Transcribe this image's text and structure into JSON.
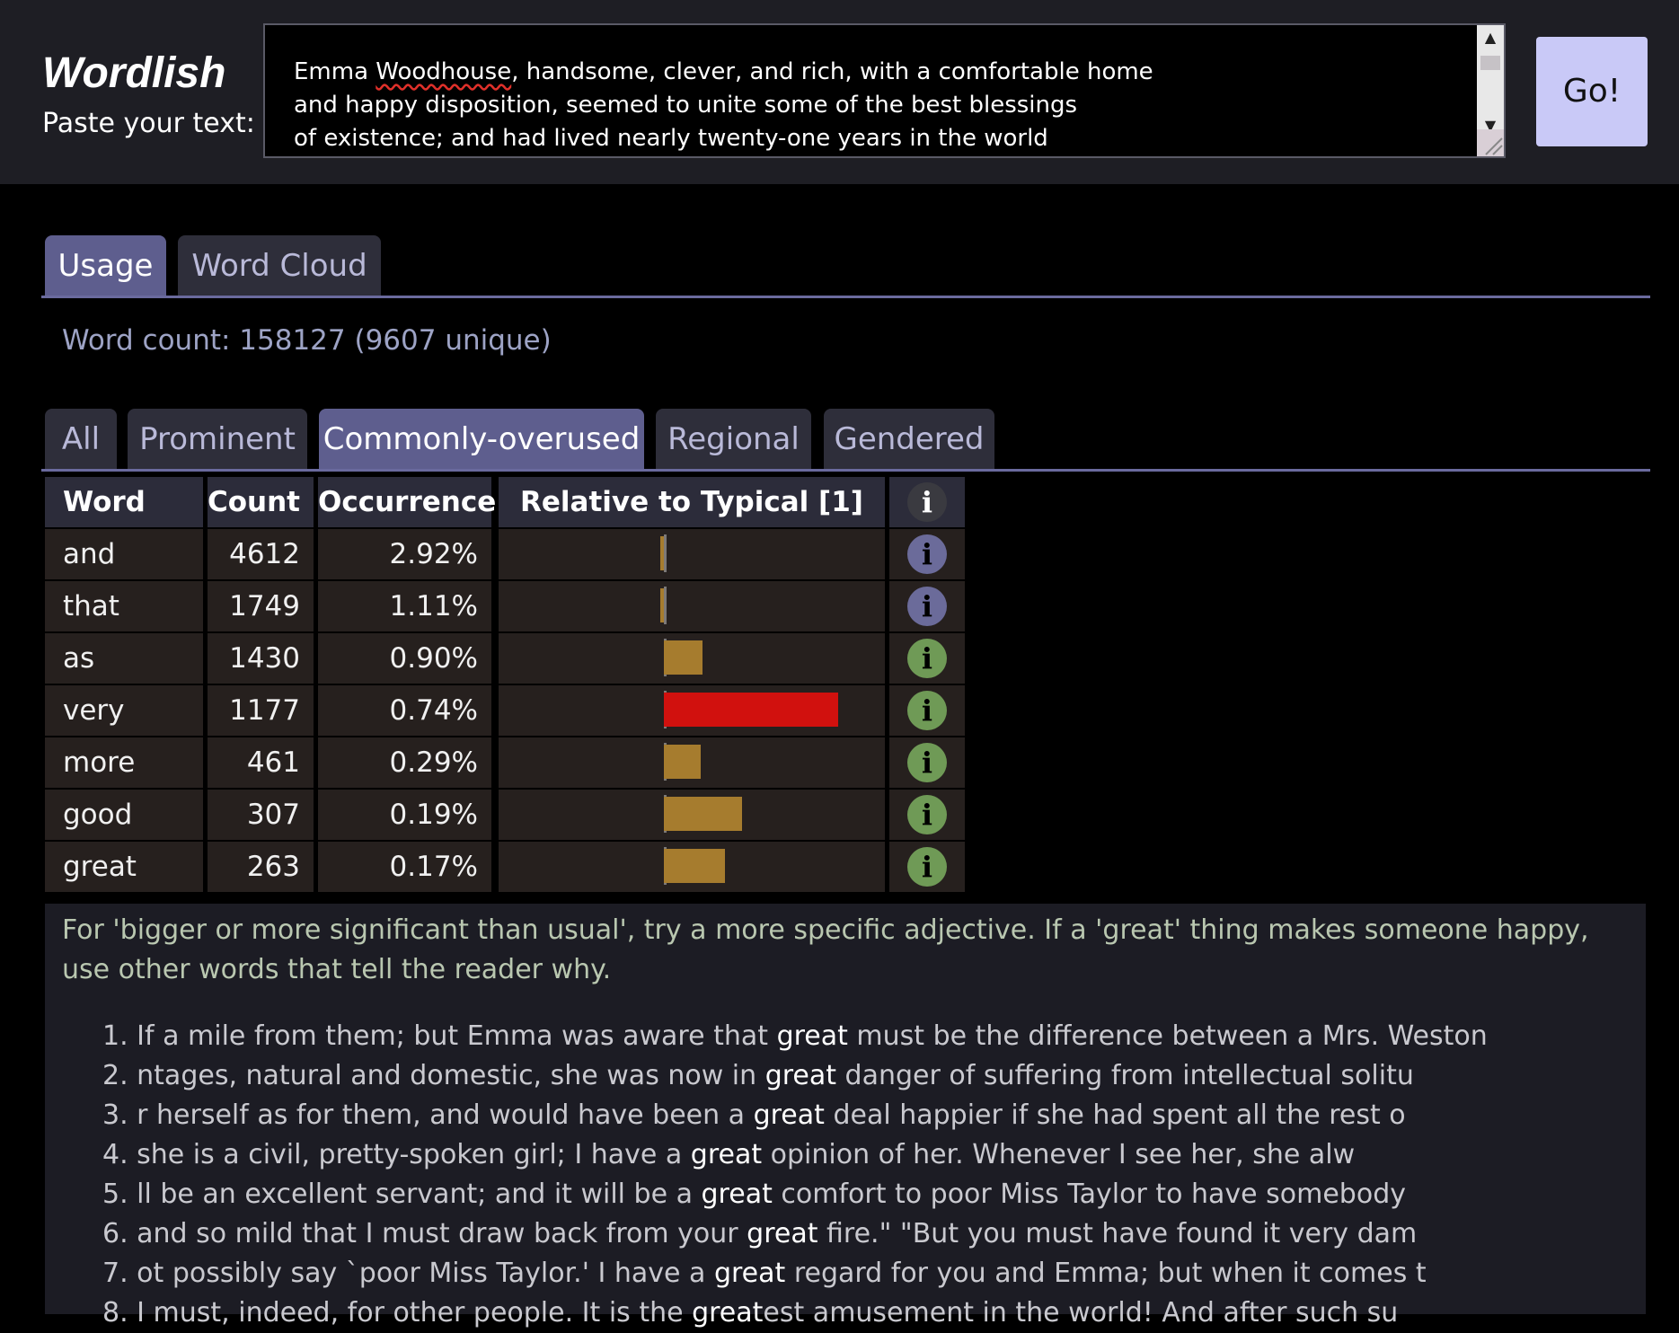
{
  "app": {
    "title": "Wordlish",
    "paste_label": "Paste your text:",
    "input_lines": [
      "Emma Woodhouse, handsome, clever, and rich, with a comfortable home",
      "and happy disposition, seemed to unite some of the best blessings",
      "of existence; and had lived nearly twenty-one years in the world"
    ],
    "go_label": "Go!"
  },
  "main_tabs": [
    {
      "label": "Usage",
      "active": true
    },
    {
      "label": "Word Cloud",
      "active": false
    }
  ],
  "word_count_text": "Word count: 158127 (9607 unique)",
  "sub_tabs": [
    {
      "label": "All",
      "active": false
    },
    {
      "label": "Prominent",
      "active": false
    },
    {
      "label": "Commonly-overused",
      "active": true
    },
    {
      "label": "Regional",
      "active": false
    },
    {
      "label": "Gendered",
      "active": false
    }
  ],
  "table": {
    "headers": [
      "Word",
      "Count",
      "Occurrence",
      "Relative to Typical [1]"
    ],
    "rows": [
      {
        "word": "and",
        "count": "4612",
        "occurrence": "2.92%",
        "relative": -0.02,
        "info_color": "#6b6b9a"
      },
      {
        "word": "that",
        "count": "1749",
        "occurrence": "1.11%",
        "relative": -0.02,
        "info_color": "#6b6b9a"
      },
      {
        "word": "as",
        "count": "1430",
        "occurrence": "0.90%",
        "relative": 0.22,
        "info_color": "#6f9a56"
      },
      {
        "word": "very",
        "count": "1177",
        "occurrence": "0.74%",
        "relative": 1.0,
        "info_color": "#6f9a56"
      },
      {
        "word": "more",
        "count": "461",
        "occurrence": "0.29%",
        "relative": 0.21,
        "info_color": "#6f9a56"
      },
      {
        "word": "good",
        "count": "307",
        "occurrence": "0.19%",
        "relative": 0.45,
        "info_color": "#6f9a56"
      },
      {
        "word": "great",
        "count": "263",
        "occurrence": "0.17%",
        "relative": 0.35,
        "info_color": "#6f9a56"
      }
    ],
    "header_info_color": "#3a3a40",
    "bar_color": "#a67c2e",
    "bar_highlight_color": "#d1110e"
  },
  "detail": {
    "advice": "For 'bigger or more significant than usual', try a more specific adjective. If a 'great' thing makes someone happy, use other words that tell the reader why.",
    "examples": [
      {
        "before": "1. If a mile from them; but Emma was aware that ",
        "word": "great",
        "after": " must be the difference between a Mrs. Weston"
      },
      {
        "before": "2. ntages, natural and domestic, she was now in ",
        "word": "great",
        "after": " danger of suffering from intellectual solitu"
      },
      {
        "before": "3. r herself as for them, and would have been a ",
        "word": "great",
        "after": " deal happier if she had spent all the rest o"
      },
      {
        "before": "4. she is a civil, pretty-spoken girl; I have a ",
        "word": "great",
        "after": " opinion of her. Whenever I see her, she alw"
      },
      {
        "before": "5. ll be an excellent servant; and it will be a ",
        "word": "great",
        "after": " comfort to poor Miss Taylor to have somebody"
      },
      {
        "before": "6. and so mild that I must draw back from your ",
        "word": "great",
        "after": " fire.\" \"But you must have found it very dam"
      },
      {
        "before": "7. ot possibly say `poor Miss Taylor.' I have a ",
        "word": "great",
        "after": " regard for you and Emma; but when it comes t"
      },
      {
        "before": "8. I must, indeed, for other people. It is the ",
        "word": "great",
        "after": "est amusement in the world! And after such su"
      }
    ]
  }
}
